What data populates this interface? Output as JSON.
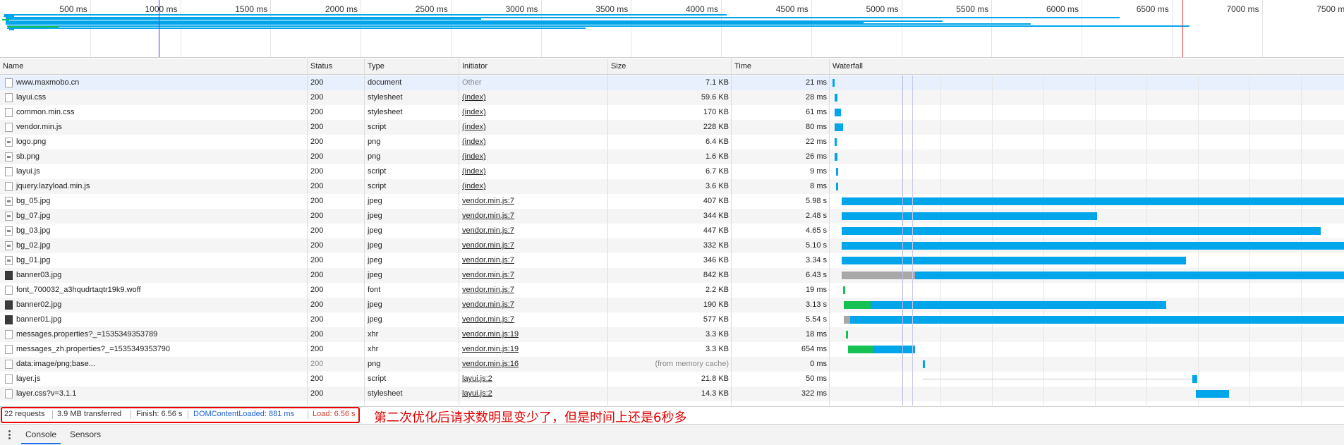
{
  "overview": {
    "tick_labels": [
      "500 ms",
      "1000 ms",
      "1500 ms",
      "2000 ms",
      "2500 ms",
      "3000 ms",
      "3500 ms",
      "4000 ms",
      "4500 ms",
      "5000 ms",
      "5500 ms",
      "6000 ms",
      "6500 ms",
      "7000 ms",
      "7500 ms"
    ],
    "colors": {
      "download": "#00a6e9",
      "waiting": "#14c152",
      "domcontentloaded": "#3b3bd6",
      "load": "#e34141"
    }
  },
  "columns": {
    "name": "Name",
    "status": "Status",
    "type": "Type",
    "initiator": "Initiator",
    "size": "Size",
    "time": "Time",
    "waterfall": "Waterfall"
  },
  "requests": [
    {
      "name": "www.maxmobo.cn",
      "status": "200",
      "type": "document",
      "initiator": "Other",
      "size": "7.1 KB",
      "time": "21 ms",
      "icon": "document-icon"
    },
    {
      "name": "layui.css",
      "status": "200",
      "type": "stylesheet",
      "initiator": "(index)",
      "size": "59.6 KB",
      "time": "28 ms",
      "icon": "file-icon"
    },
    {
      "name": "common.min.css",
      "status": "200",
      "type": "stylesheet",
      "initiator": "(index)",
      "size": "170 KB",
      "time": "61 ms",
      "icon": "file-icon"
    },
    {
      "name": "vendor.min.js",
      "status": "200",
      "type": "script",
      "initiator": "(index)",
      "size": "228 KB",
      "time": "80 ms",
      "icon": "file-icon"
    },
    {
      "name": "logo.png",
      "status": "200",
      "type": "png",
      "initiator": "(index)",
      "size": "6.4 KB",
      "time": "22 ms",
      "icon": "image-icon"
    },
    {
      "name": "sb.png",
      "status": "200",
      "type": "png",
      "initiator": "(index)",
      "size": "1.6 KB",
      "time": "26 ms",
      "icon": "image-icon"
    },
    {
      "name": "layui.js",
      "status": "200",
      "type": "script",
      "initiator": "(index)",
      "size": "6.7 KB",
      "time": "9 ms",
      "icon": "file-icon"
    },
    {
      "name": "jquery.lazyload.min.js",
      "status": "200",
      "type": "script",
      "initiator": "(index)",
      "size": "3.6 KB",
      "time": "8 ms",
      "icon": "file-icon"
    },
    {
      "name": "bg_05.jpg",
      "status": "200",
      "type": "jpeg",
      "initiator": "vendor.min.js:7",
      "size": "407 KB",
      "time": "5.98 s",
      "icon": "image-icon"
    },
    {
      "name": "bg_07.jpg",
      "status": "200",
      "type": "jpeg",
      "initiator": "vendor.min.js:7",
      "size": "344 KB",
      "time": "2.48 s",
      "icon": "image-icon"
    },
    {
      "name": "bg_03.jpg",
      "status": "200",
      "type": "jpeg",
      "initiator": "vendor.min.js:7",
      "size": "447 KB",
      "time": "4.65 s",
      "icon": "image-icon"
    },
    {
      "name": "bg_02.jpg",
      "status": "200",
      "type": "jpeg",
      "initiator": "vendor.min.js:7",
      "size": "332 KB",
      "time": "5.10 s",
      "icon": "image-icon"
    },
    {
      "name": "bg_01.jpg",
      "status": "200",
      "type": "jpeg",
      "initiator": "vendor.min.js:7",
      "size": "346 KB",
      "time": "3.34 s",
      "icon": "image-icon"
    },
    {
      "name": "banner03.jpg",
      "status": "200",
      "type": "jpeg",
      "initiator": "vendor.min.js:7",
      "size": "842 KB",
      "time": "6.43 s",
      "icon": "dark-image-icon"
    },
    {
      "name": "font_700032_a3hqudrtaqtr19k9.woff",
      "status": "200",
      "type": "font",
      "initiator": "vendor.min.js:7",
      "size": "2.2 KB",
      "time": "19 ms",
      "icon": "file-icon"
    },
    {
      "name": "banner02.jpg",
      "status": "200",
      "type": "jpeg",
      "initiator": "vendor.min.js:7",
      "size": "190 KB",
      "time": "3.13 s",
      "icon": "dark-image-icon"
    },
    {
      "name": "banner01.jpg",
      "status": "200",
      "type": "jpeg",
      "initiator": "vendor.min.js:7",
      "size": "577 KB",
      "time": "5.54 s",
      "icon": "dark-image-icon"
    },
    {
      "name": "messages.properties?_=1535349353789",
      "status": "200",
      "type": "xhr",
      "initiator": "vendor.min.js:19",
      "size": "3.3 KB",
      "time": "18 ms",
      "icon": "file-icon"
    },
    {
      "name": "messages_zh.properties?_=1535349353790",
      "status": "200",
      "type": "xhr",
      "initiator": "vendor.min.js:19",
      "size": "3.3 KB",
      "time": "654 ms",
      "icon": "file-icon"
    },
    {
      "name": "data:image/png;base...",
      "status": "200",
      "type": "png",
      "initiator": "vendor.min.js:16",
      "size": "(from memory cache)",
      "time": "0 ms",
      "icon": "file-icon",
      "muted": true
    },
    {
      "name": "layer.js",
      "status": "200",
      "type": "script",
      "initiator": "layui.js:2",
      "size": "21.8 KB",
      "time": "50 ms",
      "icon": "file-icon"
    },
    {
      "name": "layer.css?v=3.1.1",
      "status": "200",
      "type": "stylesheet",
      "initiator": "layui.js:2",
      "size": "14.3 KB",
      "time": "322 ms",
      "icon": "file-icon"
    }
  ],
  "status_bar": {
    "requests": "22 requests",
    "transferred": "3.9 MB transferred",
    "finish": "Finish: 6.56 s",
    "domcontentloaded": "DOMContentLoaded: 881 ms",
    "load": "Load: 6.56 s",
    "annotation": "第二次优化后请求数明显变少了，但是时间上还是6秒多",
    "colors": {
      "domcontentloaded": "#1a5fd1",
      "load": "#d13a2b",
      "annotation": "#e00000"
    }
  },
  "drawer": {
    "tabs": [
      "Console",
      "Sensors"
    ]
  }
}
